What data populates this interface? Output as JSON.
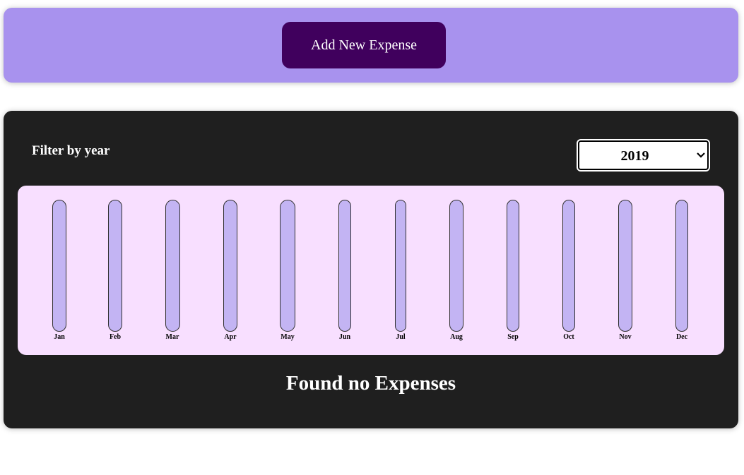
{
  "new_expense": {
    "button_label": "Add New Expense"
  },
  "filter": {
    "label": "Filter by year",
    "selected_year": "2019"
  },
  "chart_data": {
    "type": "bar",
    "categories": [
      "Jan",
      "Feb",
      "Mar",
      "Apr",
      "May",
      "Jun",
      "Jul",
      "Aug",
      "Sep",
      "Oct",
      "Nov",
      "Dec"
    ],
    "values": [
      0,
      0,
      0,
      0,
      0,
      0,
      0,
      0,
      0,
      0,
      0,
      0
    ]
  },
  "message": {
    "empty": "Found no Expenses"
  },
  "colors": {
    "header_bg": "#a892ee",
    "button_bg": "#40005d",
    "panel_bg": "#1f1f1f",
    "chart_bg": "#f8dfff",
    "bar_empty": "#c3b4f3"
  }
}
